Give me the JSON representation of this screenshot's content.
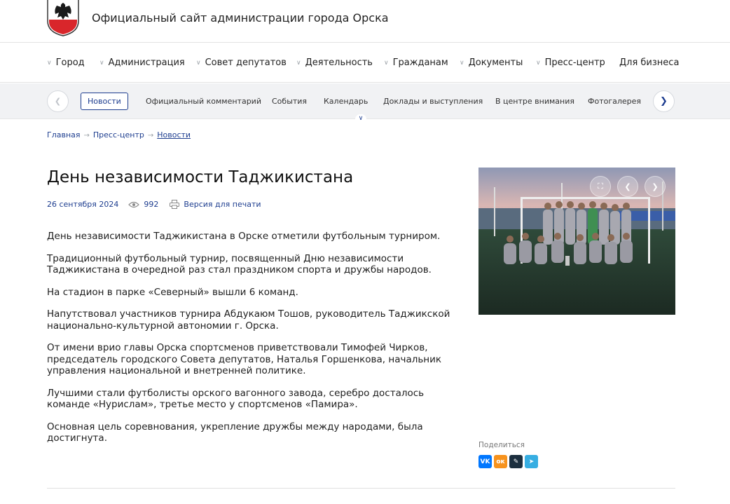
{
  "header": {
    "title": "Официальный сайт администрации города Орска"
  },
  "mainnav": {
    "items": [
      {
        "label": "Город",
        "chevron": true
      },
      {
        "label": "Администрация",
        "chevron": true
      },
      {
        "label": "Совет депутатов",
        "chevron": true
      },
      {
        "label": "Деятельность",
        "chevron": true
      },
      {
        "label": "Гражданам",
        "chevron": true
      },
      {
        "label": "Документы",
        "chevron": true
      },
      {
        "label": "Пресс-центр",
        "chevron": true
      },
      {
        "label": "Для бизнеса",
        "chevron": false
      }
    ]
  },
  "subnav": {
    "tabs": [
      {
        "label": "Новости",
        "active": true
      },
      {
        "label": "Официальный комментарий"
      },
      {
        "label": "События"
      },
      {
        "label": "Календарь"
      },
      {
        "label": "Доклады и выступления"
      },
      {
        "label": "В центре внимания"
      },
      {
        "label": "Фотогалерея"
      }
    ]
  },
  "breadcrumb": {
    "items": [
      "Главная",
      "Пресс-центр",
      "Новости"
    ],
    "separator": "→"
  },
  "article": {
    "title": "День независимости Таджикистана",
    "date": "26 сентября 2024",
    "views": "992",
    "print_label": "Версия для печати",
    "paragraphs": [
      "День независимости Таджикистана в Орске отметили футбольным турниром.",
      "Традиционный футбольный турнир, посвященный Дню независимости Таджикистана в очередной раз стал праздником спорта и дружбы народов.",
      "На стадион в парке «Северный» вышли 6 команд.",
      "Напутствовал участников турнира  Абдукаюм Тошов, руководитель Таджикской национально-культурной автономии г. Орска.",
      "От имени врио главы Орска спортсменов приветствовали Тимофей Чирков, председатель городского Совета депутатов, Наталья Горшенкова, начальник управления национальной и внетренней политике.",
      "Лучшими стали футболисты орского вагонного завода, серебро досталось команде «Нурислам», третье место у спортсменов «Памира».",
      "Основная цель соревнования, укрепление дружбы между народами, была достигнута."
    ]
  },
  "share": {
    "label": "Поделиться",
    "buttons": [
      {
        "name": "vk",
        "glyph": "VK",
        "color": "#0077ff"
      },
      {
        "name": "ok",
        "glyph": "ок",
        "color": "#f7931e"
      },
      {
        "name": "lj",
        "glyph": "✎",
        "color": "#1c2f3f"
      },
      {
        "name": "telegram",
        "glyph": "➤",
        "color": "#37aee2"
      }
    ]
  },
  "colors": {
    "accent": "#1d3d8f",
    "subnav_bg": "#f1f2f4"
  }
}
